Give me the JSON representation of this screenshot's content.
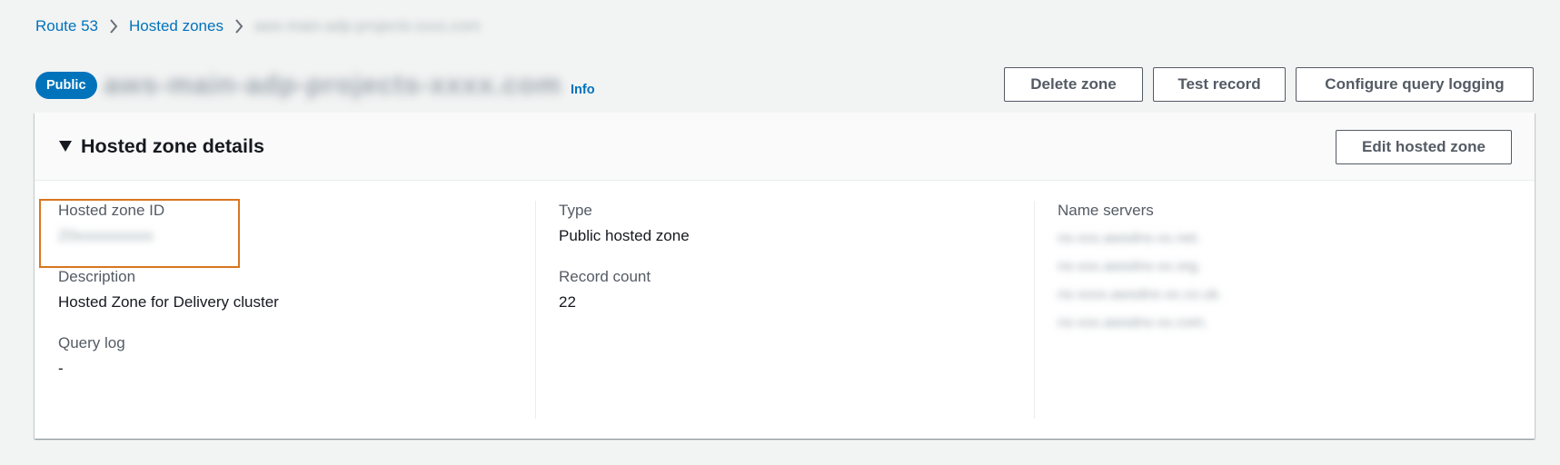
{
  "breadcrumb": {
    "items": [
      "Route 53",
      "Hosted zones"
    ],
    "current": "aws-main-adp-projects-xxxx.com"
  },
  "header": {
    "badge": "Public",
    "zone_name": "aws-main-adp-projects-xxxx.com",
    "info": "Info"
  },
  "actions": {
    "delete": "Delete zone",
    "test": "Test record",
    "configure": "Configure query logging"
  },
  "panel": {
    "title": "Hosted zone details",
    "edit": "Edit hosted zone",
    "fields": {
      "zone_id_label": "Hosted zone ID",
      "zone_id_value": "Z0xxxxxxxxxx",
      "description_label": "Description",
      "description_value": "Hosted Zone for Delivery cluster",
      "query_log_label": "Query log",
      "query_log_value": "-",
      "type_label": "Type",
      "type_value": "Public hosted zone",
      "record_count_label": "Record count",
      "record_count_value": "22",
      "name_servers_label": "Name servers",
      "name_servers": [
        "ns-xxx.awsdns-xx.net.",
        "ns-xxx.awsdns-xx.org.",
        "ns-xxxx.awsdns-xx.co.uk.",
        "ns-xxx.awsdns-xx.com."
      ]
    }
  },
  "colors": {
    "link": "#0073bb",
    "highlight": "#d9761f",
    "background": "#f2f3f3"
  }
}
